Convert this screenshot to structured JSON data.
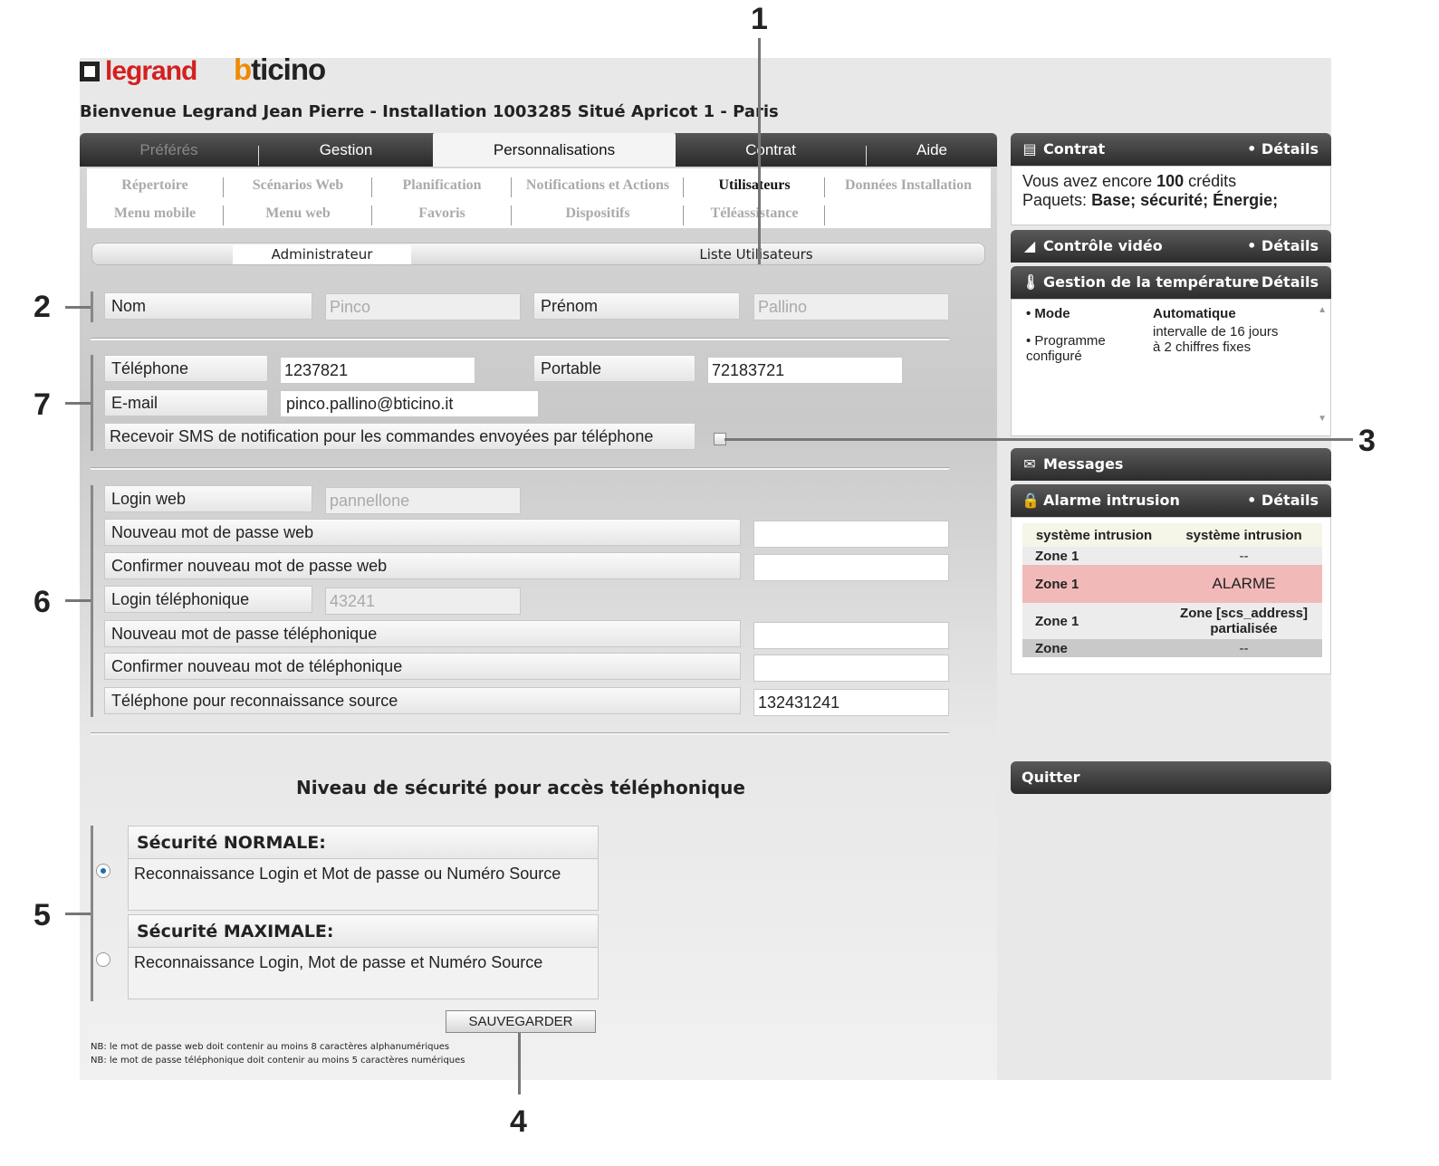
{
  "header": {
    "logo_legrand": "legrand",
    "logo_bticino": "bticino",
    "welcome": "Bienvenue Legrand Jean Pierre - Installation 1003285 Situé Apricot 1 - Paris"
  },
  "tabs": [
    "Préférés",
    "Gestion",
    "Personnalisations",
    "Contrat",
    "Aide"
  ],
  "subnav": {
    "row1": [
      "Répertoire",
      "Scénarios Web",
      "Planification",
      "Notifications et Actions",
      "Utilisateurs",
      "Données Installation"
    ],
    "row2": [
      "Menu mobile",
      "Menu web",
      "Favoris",
      "Dispositifs",
      "Téléassistance"
    ]
  },
  "subtabs": {
    "admin": "Administrateur",
    "list": "Liste Utilisateurs"
  },
  "form": {
    "nom_label": "Nom",
    "nom_value": "Pinco",
    "prenom_label": "Prénom",
    "prenom_value": "Pallino",
    "tel_label": "Téléphone",
    "tel_value": "1237821",
    "portable_label": "Portable",
    "portable_value": "72183721",
    "email_label": "E-mail",
    "email_value": "pinco.pallino@bticino.it",
    "sms_label": "Recevoir SMS de notification pour les commandes envoyées par téléphone",
    "login_web_label": "Login web",
    "login_web_value": "pannellone",
    "new_pw_web_label": "Nouveau mot de passe web",
    "confirm_pw_web_label": "Confirmer nouveau mot de passe web",
    "login_tel_label": "Login téléphonique",
    "login_tel_value": "43241",
    "new_pw_tel_label": "Nouveau mot de passe téléphonique",
    "confirm_pw_tel_label": "Confirmer nouveau mot de téléphonique",
    "tel_source_label": "Téléphone pour reconnaissance source",
    "tel_source_value": "132431241"
  },
  "security": {
    "title": "Niveau de sécurité pour accès téléphonique",
    "normal_title": "Sécurité NORMALE:",
    "normal_desc": "Reconnaissance Login et Mot de passe ou Numéro Source",
    "max_title": "Sécurité MAXIMALE:",
    "max_desc": "Reconnaissance Login, Mot de passe et Numéro Source",
    "selected": "normal"
  },
  "save_label": "SAUVEGARDER",
  "notes": [
    "NB: le mot de passe web doit contenir au moins 8 caractères alphanumériques",
    "NB: le mot de passe téléphonique doit contenir au moins 5 caractères numériques"
  ],
  "widgets": {
    "details": "• Détails",
    "contrat": {
      "title": "Contrat",
      "line1_pre": "Vous avez encore ",
      "credits": "100",
      "line1_post": " crédits",
      "line2_pre": "Paquets: ",
      "packages": "Base; sécurité; Énergie;"
    },
    "video": {
      "title": "Contrôle vidéo"
    },
    "temp": {
      "title": "Gestion de la température",
      "mode_label": "• Mode",
      "mode_value": "Automatique",
      "prog_label": "• Programme configuré",
      "prog_value": "intervalle de 16 jours à 2 chiffres fixes"
    },
    "messages": {
      "title": "Messages"
    },
    "alarm": {
      "title": "Alarme intrusion",
      "headers": [
        "système intrusion",
        "système intrusion"
      ],
      "rows": [
        [
          "Zone 1",
          "--"
        ],
        [
          "Zone 1",
          "ALARME"
        ],
        [
          "Zone 1",
          "Zone [scs_address] partialisée"
        ],
        [
          "Zone",
          "--"
        ]
      ]
    },
    "quit": "Quitter"
  },
  "annotations": [
    "1",
    "2",
    "3",
    "4",
    "5",
    "6",
    "7"
  ],
  "colors": {
    "alarm_row": "#f2b9b9",
    "legrand_red": "#d42020",
    "bticino_orange": "#f08a00",
    "radio_selected": "#1a6fb0"
  }
}
